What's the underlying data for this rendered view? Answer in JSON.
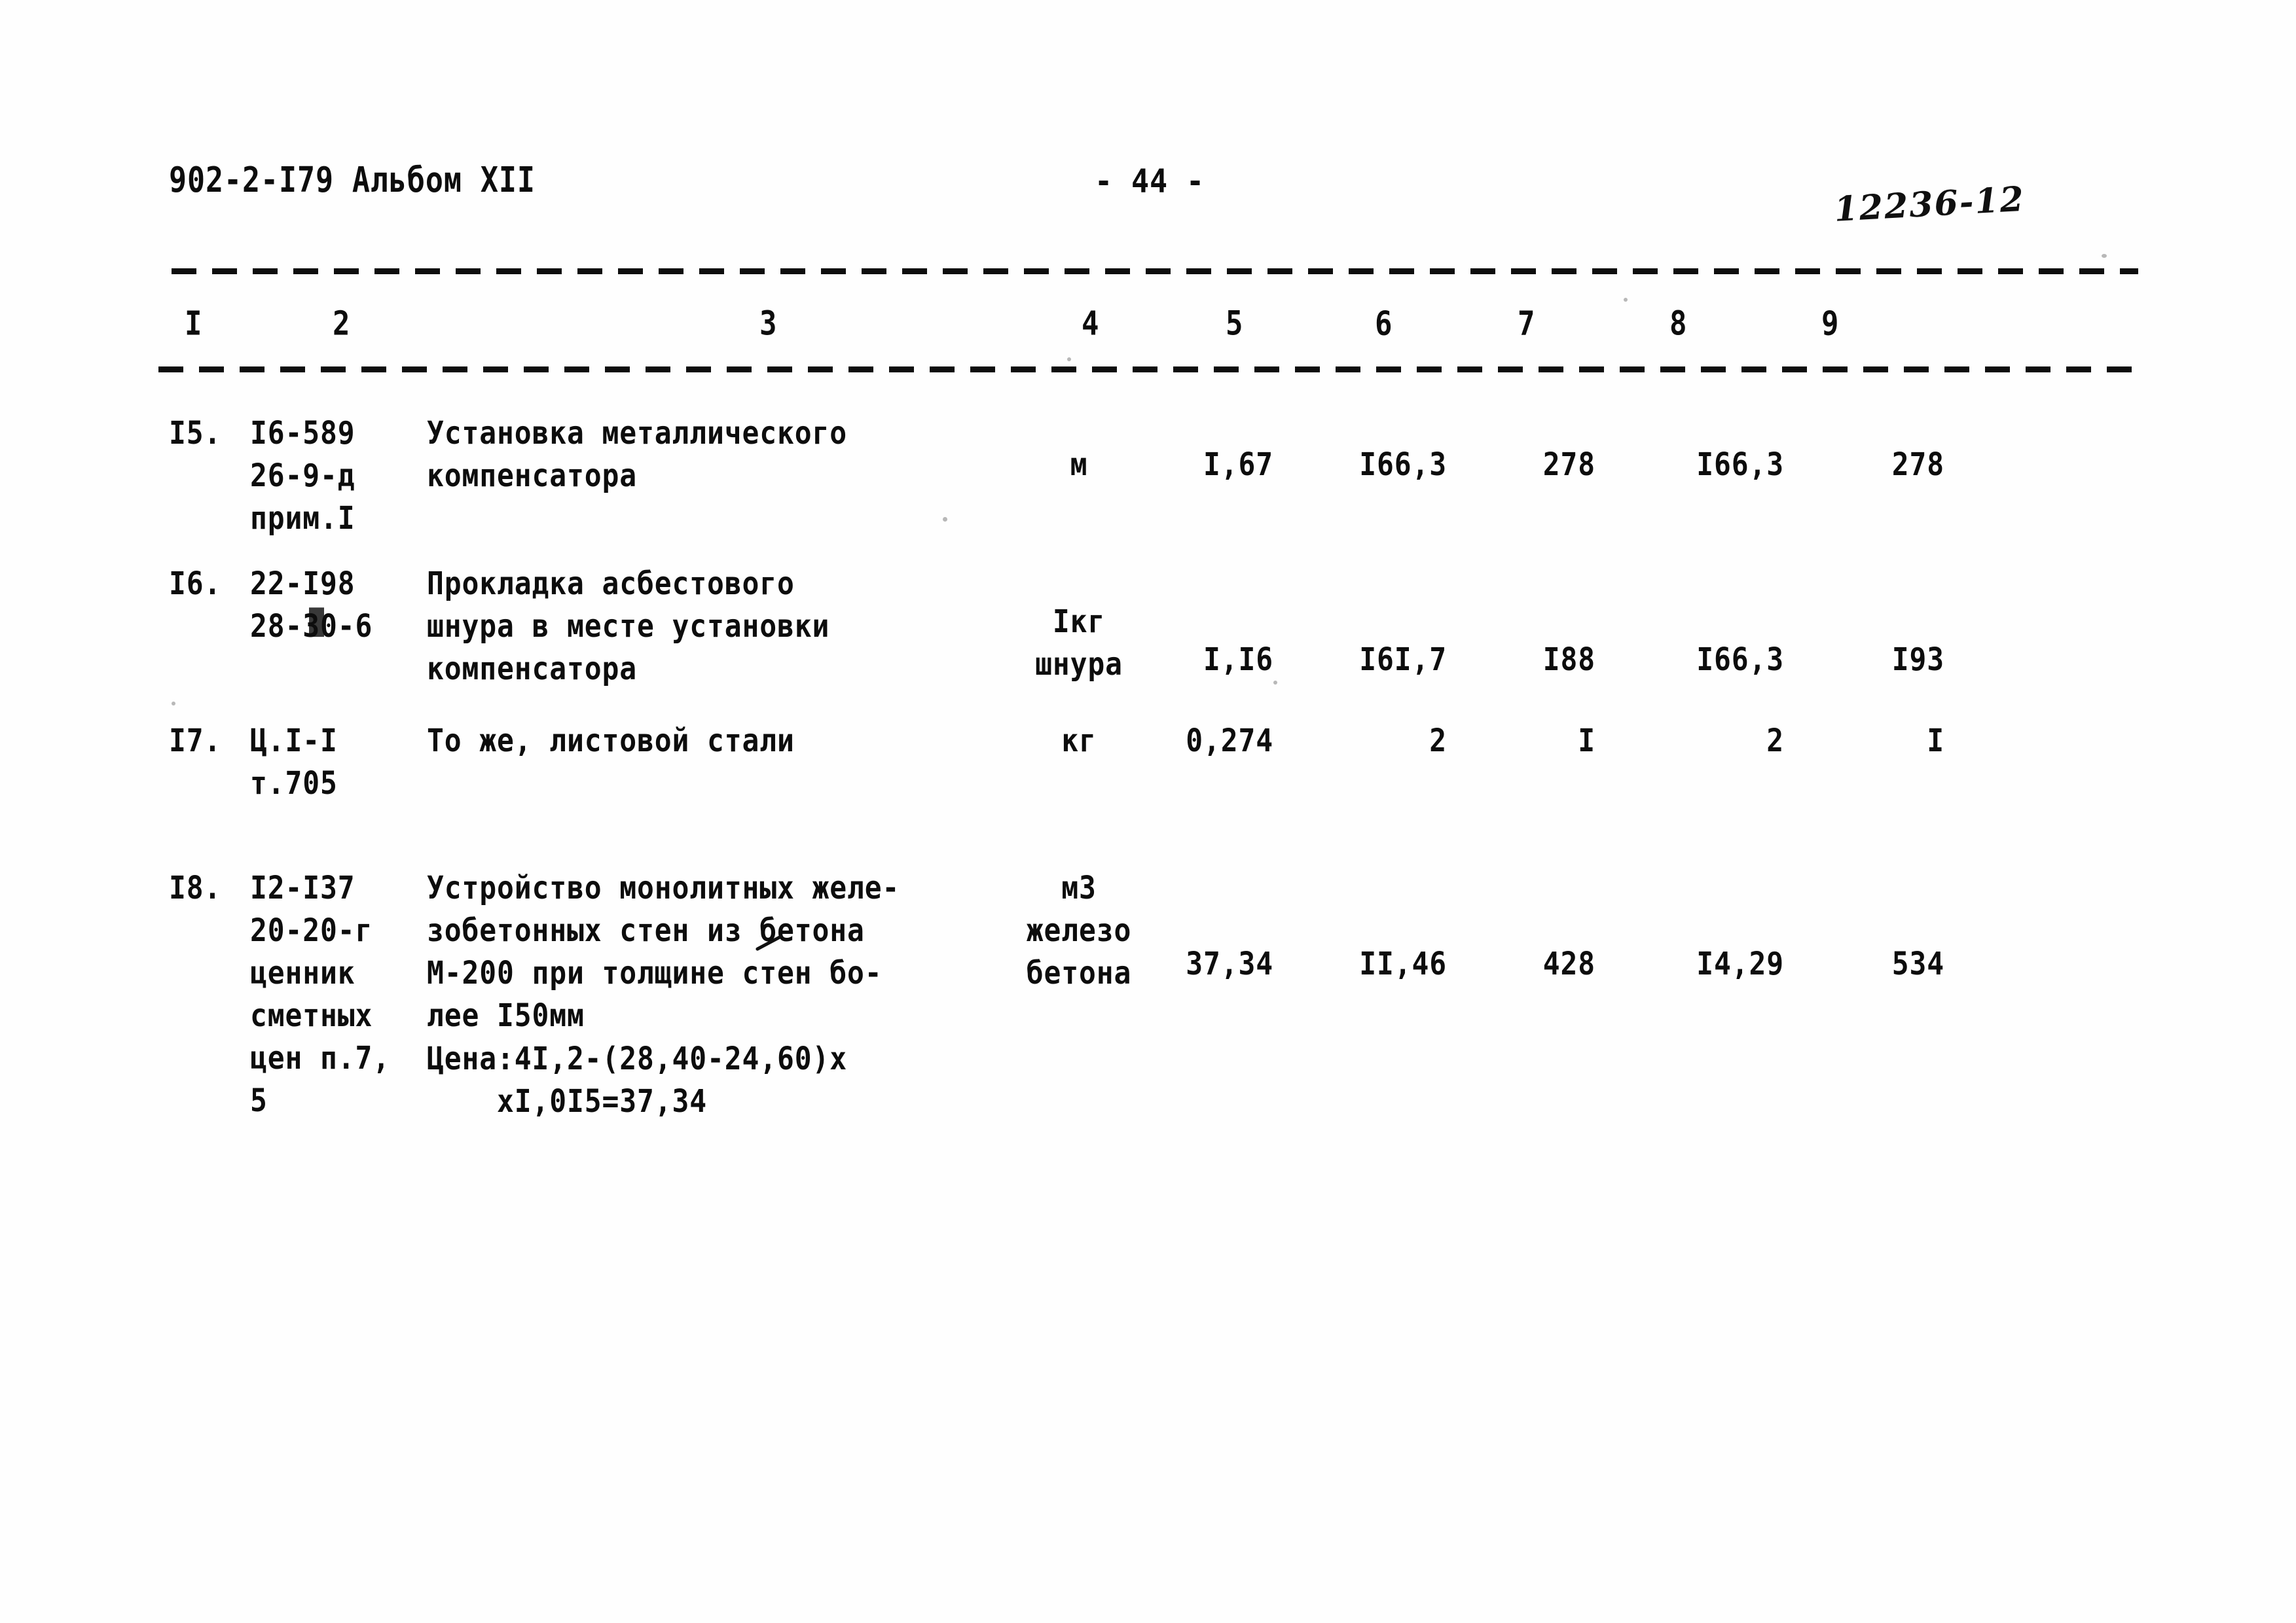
{
  "header": {
    "doc_code": "902-2-I79 Альбом XII",
    "page_number": "- 44 -",
    "archive_stamp": "12236-12"
  },
  "table": {
    "column_headers": [
      "I",
      "2",
      "3",
      "4",
      "5",
      "6",
      "7",
      "8",
      "9"
    ],
    "rows": [
      {
        "num": "I5.",
        "code_lines": [
          "I6-589",
          "26-9-д",
          "прим.I"
        ],
        "desc_lines": [
          "Установка металлического",
          "компенсатора"
        ],
        "unit_lines": [
          "м"
        ],
        "v5": "I,67",
        "v6": "I66,3",
        "v7": "278",
        "v8": "I66,3",
        "v9": "278"
      },
      {
        "num": "I6.",
        "code_lines": [
          "22-I98",
          "28-30-6"
        ],
        "desc_lines": [
          "Прокладка асбестового",
          "шнура в месте установки",
          "компенсатора"
        ],
        "unit_lines": [
          "Iкг",
          "шнура"
        ],
        "v5": "I,I6",
        "v6": "I6I,7",
        "v7": "I88",
        "v8": "I66,3",
        "v9": "I93"
      },
      {
        "num": "I7.",
        "code_lines": [
          "Ц.I-I",
          "т.705"
        ],
        "desc_lines": [
          "То же, листовой стали"
        ],
        "unit_lines": [
          "кг"
        ],
        "v5": "0,274",
        "v6": "2",
        "v7": "I",
        "v8": "2",
        "v9": "I"
      },
      {
        "num": "I8.",
        "code_lines": [
          "I2-I37",
          "20-20-г",
          "ценник",
          "сметных",
          "цен п.7,",
          "5"
        ],
        "desc_lines": [
          "Устройство монолитных желе-",
          "зобетонных стен из бетона",
          "М-200 при толщине стен бо-",
          "лее I50мм"
        ],
        "unit_lines": [
          "м3",
          "железо",
          "бетона"
        ],
        "v5": "37,34",
        "v6": "II,46",
        "v7": "428",
        "v8": "I4,29",
        "v9": "534",
        "formula_lines": [
          "Цена:4I,2-(28,40-24,60)х",
          "    хI,0I5=37,34"
        ]
      }
    ]
  }
}
